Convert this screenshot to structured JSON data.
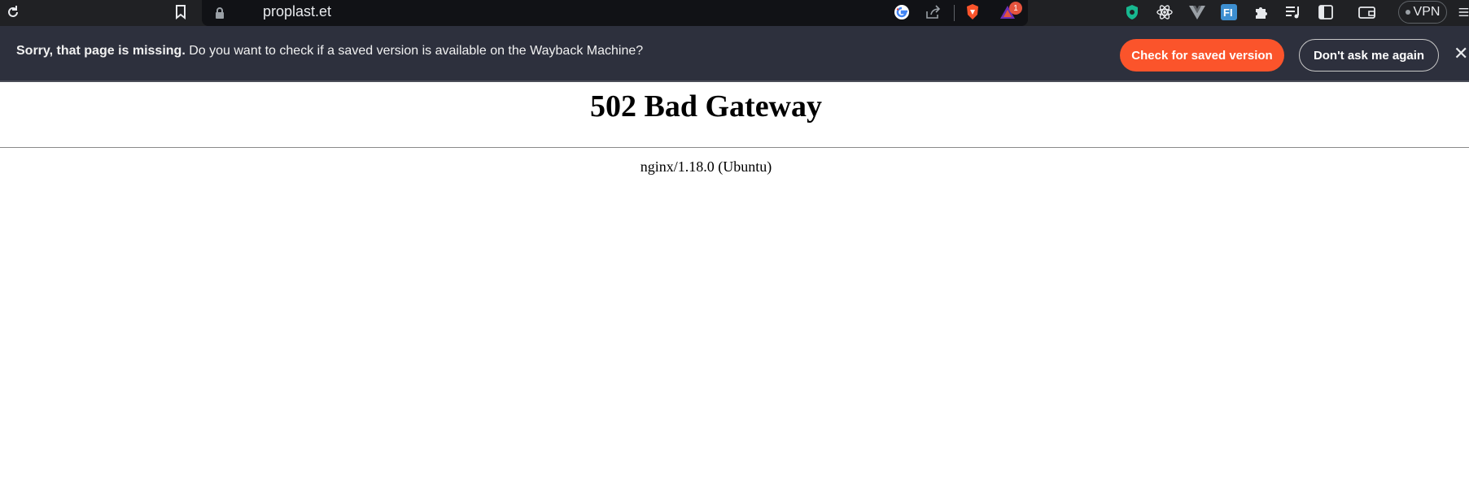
{
  "browser": {
    "url": "proplast.et",
    "vpn_label": "VPN",
    "alert_count": "1",
    "icons": [
      "reload-icon",
      "bookmark-icon",
      "lock-icon",
      "google-icon",
      "share-icon",
      "brave-shields-icon",
      "brave-rewards-icon",
      "extension-shield-icon",
      "react-devtools-icon",
      "vue-devtools-icon",
      "fi-extension-icon",
      "extensions-puzzle-icon",
      "media-playlist-icon",
      "sidebar-icon",
      "wallet-icon",
      "menu-icon"
    ]
  },
  "infobar": {
    "bold_text": "Sorry, that page is missing.",
    "message": "Do you want to check if a saved version is available on the Wayback Machine?",
    "check_button": "Check for saved version",
    "dont_ask_button": "Don't ask me again",
    "close_symbol": "✕",
    "accent_color": "#fb542b"
  },
  "page": {
    "title": "502 Bad Gateway",
    "server": "nginx/1.18.0 (Ubuntu)"
  }
}
